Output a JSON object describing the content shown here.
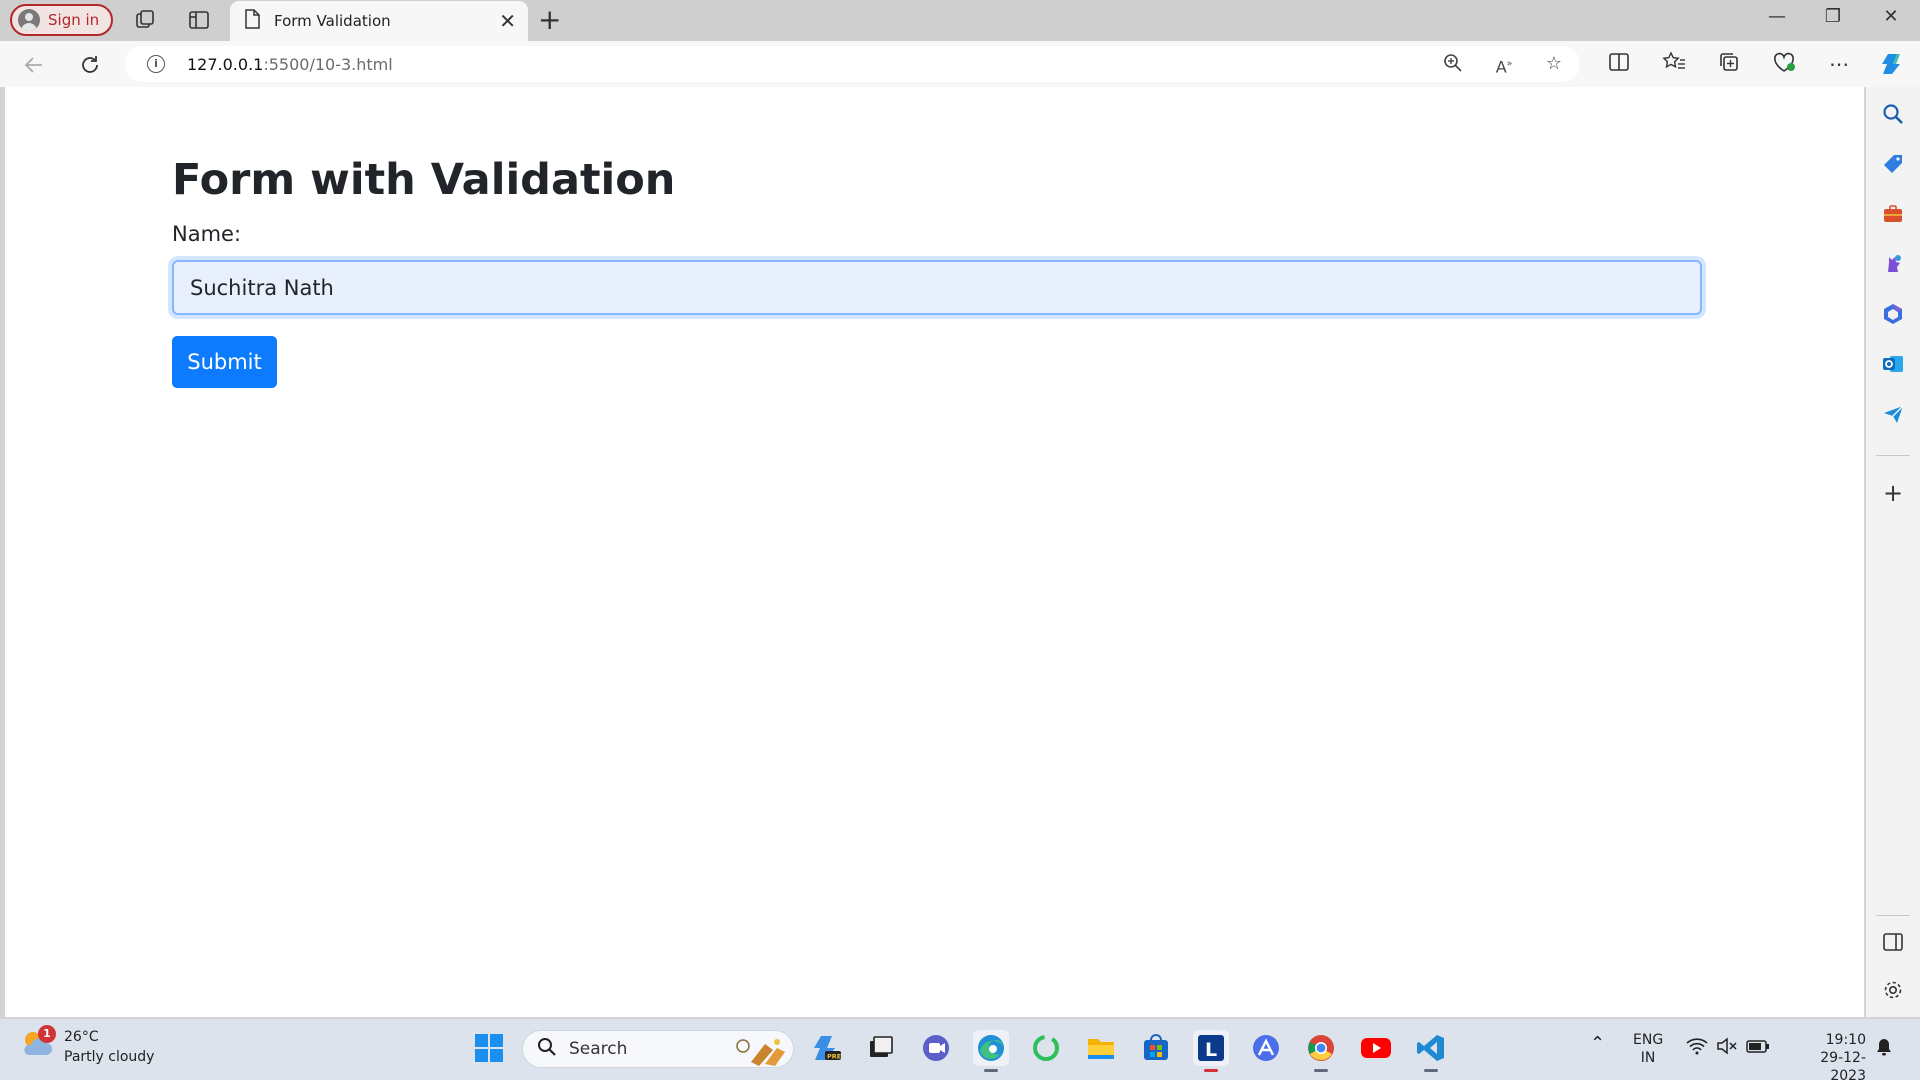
{
  "browser": {
    "signin_label": "Sign in",
    "tab_title": "Form Validation",
    "url_host": "127.0.0.1",
    "url_path": ":5500/10-3.html"
  },
  "page": {
    "heading": "Form with Validation",
    "name_label": "Name:",
    "name_value": "Suchitra Nath",
    "submit_label": "Submit"
  },
  "taskbar": {
    "weather_temp": "26°C",
    "weather_desc": "Partly cloudy",
    "weather_badge": "1",
    "search_label": "Search",
    "lang_top": "ENG",
    "lang_bottom": "IN",
    "time": "19:10",
    "date": "29-12-2023"
  },
  "colors": {
    "accent": "#0d7bfd",
    "signin_border": "#b3262c",
    "input_fill": "#e8f0fe"
  }
}
